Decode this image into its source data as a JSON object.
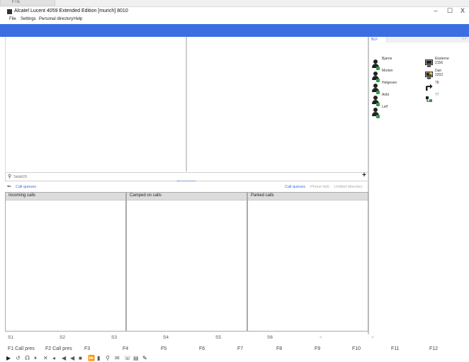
{
  "taskbar": {
    "tab_label": "FTE"
  },
  "window": {
    "title": "Alcatel Lucent 4059 Extended Edition [murich]   8010",
    "minimize": "–",
    "maximize": "☐",
    "close": "X"
  },
  "menu": [
    "File",
    "Settings",
    "Personal directory",
    "Help"
  ],
  "right_panel": {
    "tab_label": "BLF",
    "tab_controls": "‹ ›",
    "contacts": [
      {
        "name": "Bjarne",
        "number": ""
      },
      {
        "name": "Morten",
        "number": ""
      },
      {
        "name": "Helgesen",
        "number": ""
      },
      {
        "name": "Arild",
        "number": ""
      },
      {
        "name": "Leif",
        "number": ""
      }
    ],
    "devices": [
      {
        "name": "Eksterne",
        "number": "2156"
      },
      {
        "name": "Dan",
        "number": "2202"
      },
      {
        "name": "",
        "number": "78"
      },
      {
        "name": "",
        "number": "77"
      }
    ]
  },
  "search": {
    "placeholder": "Search",
    "add_button": "+"
  },
  "call_queues": {
    "back_arrow": "⇐",
    "label": "Call queues",
    "tabs": [
      "Call queues",
      "Phone lists",
      "Unified directory"
    ],
    "columns": [
      "Incoming calls",
      "Camped on calls",
      "Parked calls"
    ]
  },
  "s_keys": [
    "S1",
    "S2",
    "S3",
    "S4",
    "S5",
    "S6",
    "<",
    ">"
  ],
  "f_keys": [
    "F1 Call pres",
    "F2 Call pres",
    "F3",
    "F4",
    "F5",
    "F6",
    "F7",
    "F8",
    "F9",
    "F10",
    "F11",
    "F12"
  ],
  "toolbar_icons": [
    "play-icon",
    "redial-icon",
    "headset-icon",
    "hold-icon",
    "mute-icon",
    "volume-down-icon",
    "volume-up-icon",
    "record-icon",
    "forward-icon",
    "transfer-icon",
    "search-icon",
    "mail-icon",
    "phone-icon",
    "note-icon",
    "pen-icon"
  ],
  "colors": {
    "accent": "#3b6ee0",
    "presence_available": "#2ea043"
  }
}
